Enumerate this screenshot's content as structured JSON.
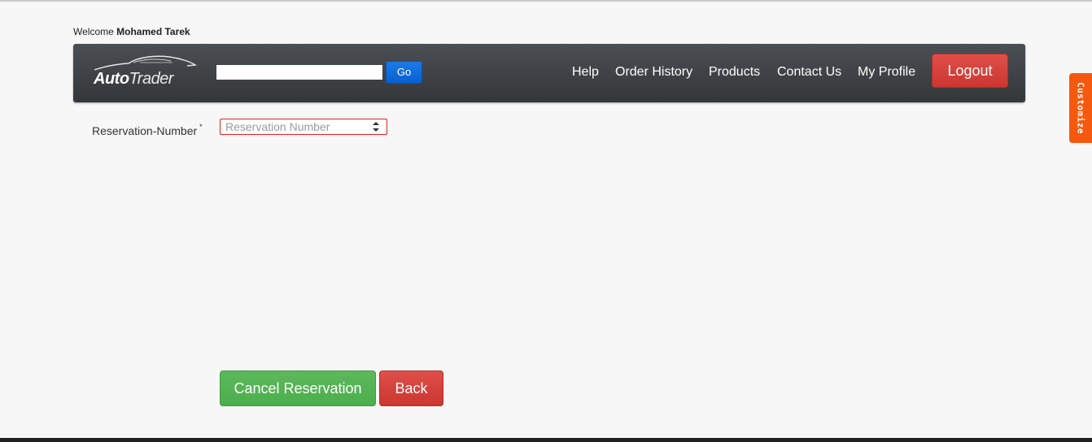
{
  "header": {
    "welcome_prefix": "Welcome",
    "user_name": "Mohamed Tarek"
  },
  "navbar": {
    "logo": {
      "part1": "Auto",
      "part2": "Trader"
    },
    "search": {
      "value": "",
      "placeholder": ""
    },
    "go_label": "Go",
    "links": [
      "Help",
      "Order History",
      "Products",
      "Contact Us",
      "My Profile"
    ],
    "logout_label": "Logout"
  },
  "form": {
    "reservation_label": "Reservation-Number",
    "required_marker": "*",
    "reservation_value": "",
    "reservation_placeholder": "Reservation Number"
  },
  "actions": {
    "cancel_label": "Cancel Reservation",
    "back_label": "Back"
  },
  "side_tab": {
    "label": "Customize"
  },
  "colors": {
    "navbar": "#3d4145",
    "go_button": "#0b6fe0",
    "logout_button": "#d9534f",
    "cancel_button": "#5cb85c",
    "back_button": "#d9534f",
    "invalid_border": "#e02020",
    "customize_tab": "#f4590f",
    "page_background": "#f7f7f7"
  }
}
